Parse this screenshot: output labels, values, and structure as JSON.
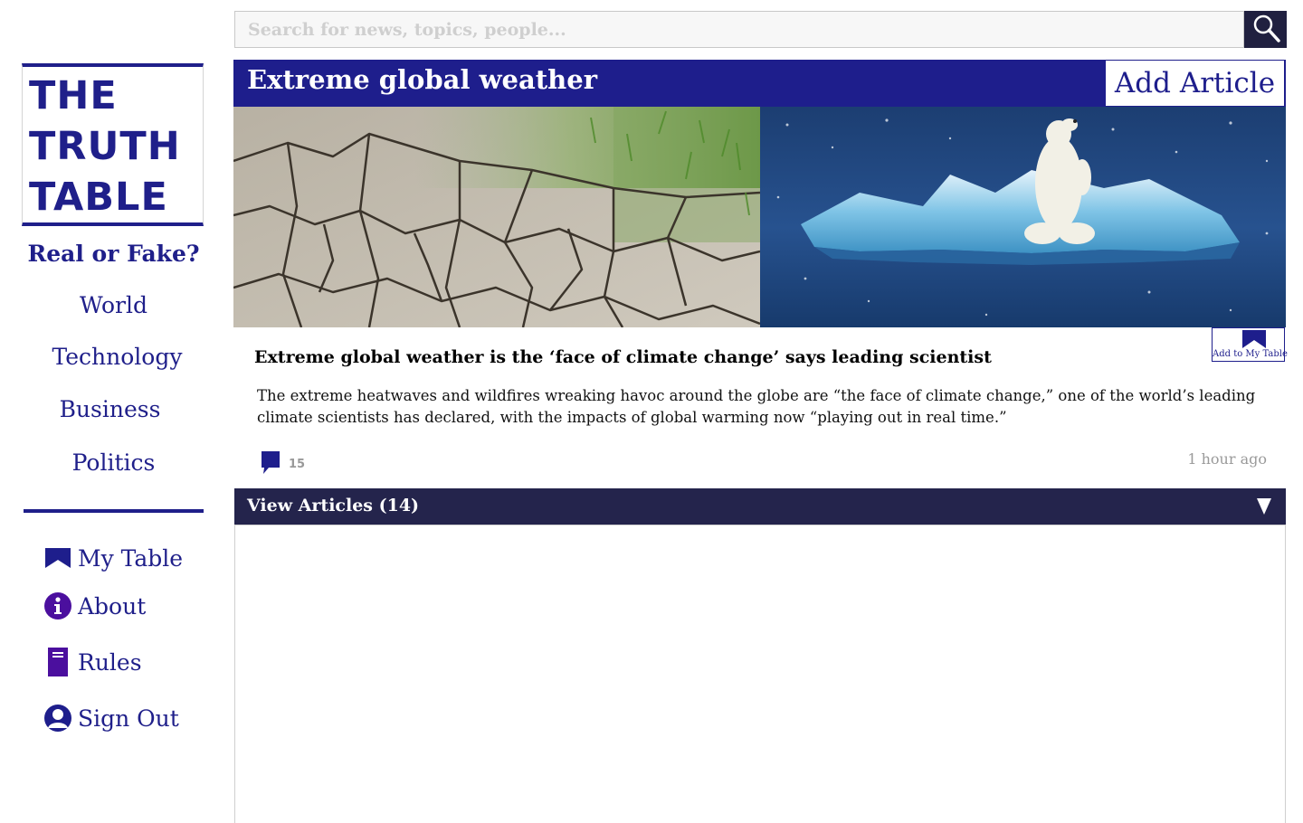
{
  "brand": {
    "logo_lines": [
      "THE",
      "TRUTH",
      "TABLE"
    ]
  },
  "sidebar": {
    "categories": [
      {
        "label": "Real or Fake?"
      },
      {
        "label": "World"
      },
      {
        "label": "Technology"
      },
      {
        "label": "Business"
      },
      {
        "label": "Politics"
      }
    ],
    "menu": [
      {
        "label": "My Table",
        "icon": "bookmark-icon"
      },
      {
        "label": "About",
        "icon": "info-icon"
      },
      {
        "label": "Rules",
        "icon": "book-icon"
      },
      {
        "label": "Sign Out",
        "icon": "user-icon"
      }
    ]
  },
  "search": {
    "placeholder": "Search for news, topics, people...",
    "value": ""
  },
  "topic": {
    "title": "Extreme global weather",
    "add_article_label": "Add Article",
    "images": [
      {
        "alt": "cracked dry earth"
      },
      {
        "alt": "polar bear on melting ice"
      }
    ]
  },
  "article": {
    "bookmark_label": "Add to My Table",
    "headline": "Extreme global weather is the ‘face of climate change’ says leading scientist",
    "summary": "The extreme heatwaves and wildfires wreaking havoc around the globe are “the face of climate change,” one of the world’s leading climate scientists has declared, with the impacts of global warming now “playing out in real time.”",
    "comment_count": "15",
    "timestamp": "1 hour ago"
  },
  "view_articles": {
    "label": "View Articles (14)"
  },
  "colors": {
    "primary": "#1e1e8c",
    "dark_bar": "#24244c",
    "accent_purple": "#4b0f9e"
  }
}
